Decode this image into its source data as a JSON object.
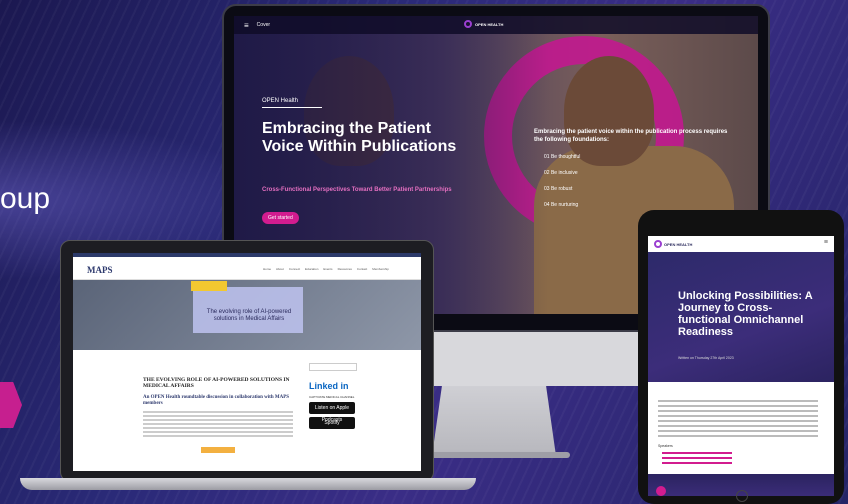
{
  "left": {
    "partial_text": "oup"
  },
  "imac": {
    "nav": {
      "menu_icon": "≡",
      "cover_label": "Cover",
      "brand": "OPEN HEALTH"
    },
    "hero": {
      "kicker": "OPEN Health",
      "title": "Embracing the Patient Voice Within Publications",
      "subtitle": "Cross-Functional Perspectives Toward Better Patient Partnerships",
      "cta": "Get started"
    },
    "foundations": {
      "intro": "Embracing the patient voice within the publication process requires the following foundations:",
      "items": [
        "01 Be thoughtful",
        "02 Be inclusive",
        "03 Be robust",
        "04 Be nurturing"
      ]
    },
    "apple_logo": ""
  },
  "laptop": {
    "logo": "MAPS",
    "nav": [
      "Home",
      "About",
      "Connect",
      "Education",
      "Events",
      "Resources",
      "Contact",
      "Membership"
    ],
    "banner": {
      "pill": "EXPLORE THE ROUNDTABLE",
      "brand": "OPEN HEALTH",
      "headline": "The evolving role of AI-powered solutions in Medical Affairs"
    },
    "article": {
      "title": "THE EVOLVING ROLE OF AI-POWERED SOLUTIONS IN MEDICAL AFFAIRS",
      "subtitle": "An OPEN Health roundtable discussion in collaboration with MAPS members"
    },
    "sidebar": {
      "search_placeholder": "Search",
      "linkedin": "Linked in",
      "section_label": "CAPTIVATE MEDICAL CHANNEL",
      "badges": [
        "Listen on Apple Podcasts",
        "Spotify"
      ]
    }
  },
  "tablet": {
    "brand": "OPEN HEALTH",
    "menu_icon": "≡",
    "title": "Unlocking Possibilities: A Journey to Cross-functional Omnichannel Readiness",
    "date": "Written on Thursday 27th April 2023",
    "speakers_label": "Speakers"
  },
  "colors": {
    "accent": "#d21c8f",
    "navy": "#2a2a5c",
    "background": "#2a2a78"
  }
}
